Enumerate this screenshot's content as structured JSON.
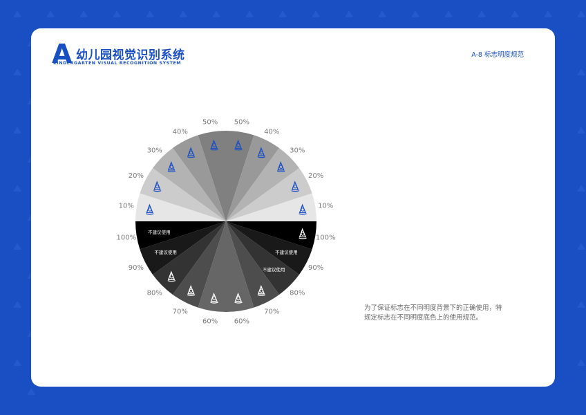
{
  "header": {
    "logo_letter": "A",
    "logo_title": "幼儿园视觉识别系统",
    "logo_subtitle": "KINDERGARTEN VISUAL RECOGNITION SYSTEM",
    "page_code": "A-8  标志明度规范"
  },
  "description": {
    "line1": "为了保证标志在不同明度背景下的正确使用，特",
    "line2": "规定标志在不同明度底色上的使用规范。"
  },
  "chart_data": {
    "type": "pie",
    "slice_count": 20,
    "upper_half_logo_color": "#1a4fc4",
    "lower_half_logo_color": "#1f1f1f",
    "warning_text": "不建议使用",
    "right_half": [
      {
        "label": "50%",
        "brightness": 50,
        "logo": true
      },
      {
        "label": "40%",
        "brightness": 40,
        "logo": true
      },
      {
        "label": "30%",
        "brightness": 30,
        "logo": true
      },
      {
        "label": "20%",
        "brightness": 20,
        "logo": true
      },
      {
        "label": "10%",
        "brightness": 10,
        "logo": true
      },
      {
        "label": "100%",
        "brightness": 100,
        "logo": true
      },
      {
        "label": "90%",
        "brightness": 90,
        "logo": false
      },
      {
        "label": "80%",
        "brightness": 80,
        "logo": false
      },
      {
        "label": "70%",
        "brightness": 70,
        "logo": true
      },
      {
        "label": "60%",
        "brightness": 60,
        "logo": true
      }
    ],
    "left_half": [
      {
        "label": "50%",
        "brightness": 50,
        "logo": true
      },
      {
        "label": "40%",
        "brightness": 40,
        "logo": true
      },
      {
        "label": "30%",
        "brightness": 30,
        "logo": true
      },
      {
        "label": "20%",
        "brightness": 20,
        "logo": true
      },
      {
        "label": "10%",
        "brightness": 10,
        "logo": true
      },
      {
        "label": "100%",
        "brightness": 100,
        "logo": false
      },
      {
        "label": "90%",
        "brightness": 90,
        "logo": false
      },
      {
        "label": "80%",
        "brightness": 80,
        "logo": true
      },
      {
        "label": "70%",
        "brightness": 70,
        "logo": true
      },
      {
        "label": "60%",
        "brightness": 60,
        "logo": true
      }
    ]
  }
}
